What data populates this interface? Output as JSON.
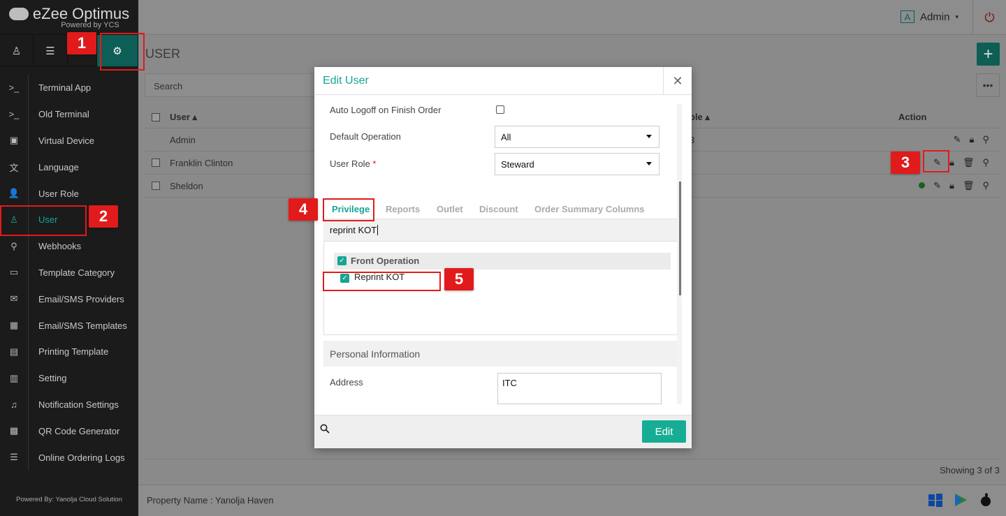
{
  "brand": {
    "name": "eZee Optimus",
    "tagline": "Powered by YCS"
  },
  "sidebar": {
    "items": [
      {
        "label": "Terminal App",
        "icon": "terminal-icon",
        "glyph": ">_"
      },
      {
        "label": "Old Terminal",
        "icon": "terminal-icon",
        "glyph": ">_"
      },
      {
        "label": "Virtual Device",
        "icon": "tablet-icon",
        "glyph": "▣"
      },
      {
        "label": "Language",
        "icon": "language-icon",
        "glyph": "文"
      },
      {
        "label": "User Role",
        "icon": "user-role-icon",
        "glyph": "👤"
      },
      {
        "label": "User",
        "icon": "user-icon",
        "glyph": "♙"
      },
      {
        "label": "Webhooks",
        "icon": "link-icon",
        "glyph": "⚲"
      },
      {
        "label": "Template Category",
        "icon": "inbox-icon",
        "glyph": "▭"
      },
      {
        "label": "Email/SMS Providers",
        "icon": "mail-icon",
        "glyph": "✉"
      },
      {
        "label": "Email/SMS Templates",
        "icon": "calendar-icon",
        "glyph": "▦"
      },
      {
        "label": "Printing Template",
        "icon": "document-icon",
        "glyph": "▤"
      },
      {
        "label": "Setting",
        "icon": "sliders-icon",
        "glyph": "▥"
      },
      {
        "label": "Notification Settings",
        "icon": "bell-icon",
        "glyph": "♫"
      },
      {
        "label": "QR Code Generator",
        "icon": "qr-code-icon",
        "glyph": "▩"
      },
      {
        "label": "Online Ordering Logs",
        "icon": "list-icon",
        "glyph": "☰"
      }
    ],
    "footer": "Powered By: Yanolja Cloud Solution"
  },
  "header": {
    "user_badge": "A",
    "user_name": "Admin"
  },
  "main": {
    "title": "USER",
    "search_placeholder": "Search",
    "columns": {
      "user": "User ▴",
      "role": "ole ▴",
      "action": "Action"
    },
    "rows": [
      {
        "user": "Admin",
        "role": "3"
      },
      {
        "user": "Franklin Clinton",
        "role": ""
      },
      {
        "user": "Sheldon",
        "role": ""
      }
    ],
    "showing": "Showing 3 of 3",
    "property": "Property Name : Yanolja Haven"
  },
  "modal": {
    "title": "Edit User",
    "auto_logoff_label": "Auto Logoff on Finish Order",
    "default_operation_label": "Default Operation",
    "default_operation_value": "All",
    "user_role_label": "User Role",
    "user_role_required": "*",
    "user_role_value": "Steward",
    "tabs": [
      "Privilege",
      "Reports",
      "Outlet",
      "Discount",
      "Order Summary Columns"
    ],
    "privilege_search": "reprint KOT",
    "group_label": "Front Operation",
    "item_label": "Reprint KOT",
    "section_label": "Personal Information",
    "address_label": "Address",
    "address_value": "ITC",
    "edit_button": "Edit"
  },
  "callouts": [
    "1",
    "2",
    "3",
    "4",
    "5"
  ],
  "colors": {
    "accent": "#17a593",
    "sidebar": "#1b1b1b",
    "callout": "#e11b1b"
  }
}
